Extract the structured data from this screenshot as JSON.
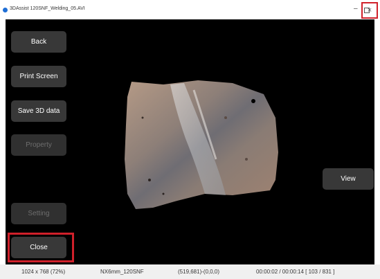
{
  "window": {
    "title": "3DAssist 120SNF_Welding_05.AVI",
    "minimize_glyph": "–",
    "close_glyph": "×"
  },
  "sidebar": {
    "back_label": "Back",
    "print_label": "Print Screen",
    "save_label": "Save 3D data",
    "property_label": "Property",
    "setting_label": "Setting",
    "close_label": "Close"
  },
  "view_button": {
    "label": "View"
  },
  "status": {
    "resolution": "1024 x 768 (72%)",
    "model": "NX6mm_120SNF",
    "coords": "(519,681)-(0,0,0)",
    "time": "00:00:02 / 00:00:14  [ 103 / 831 ]"
  },
  "colors": {
    "highlight": "#d0202a",
    "button_bg": "#383838",
    "viewport_bg": "#000000"
  }
}
